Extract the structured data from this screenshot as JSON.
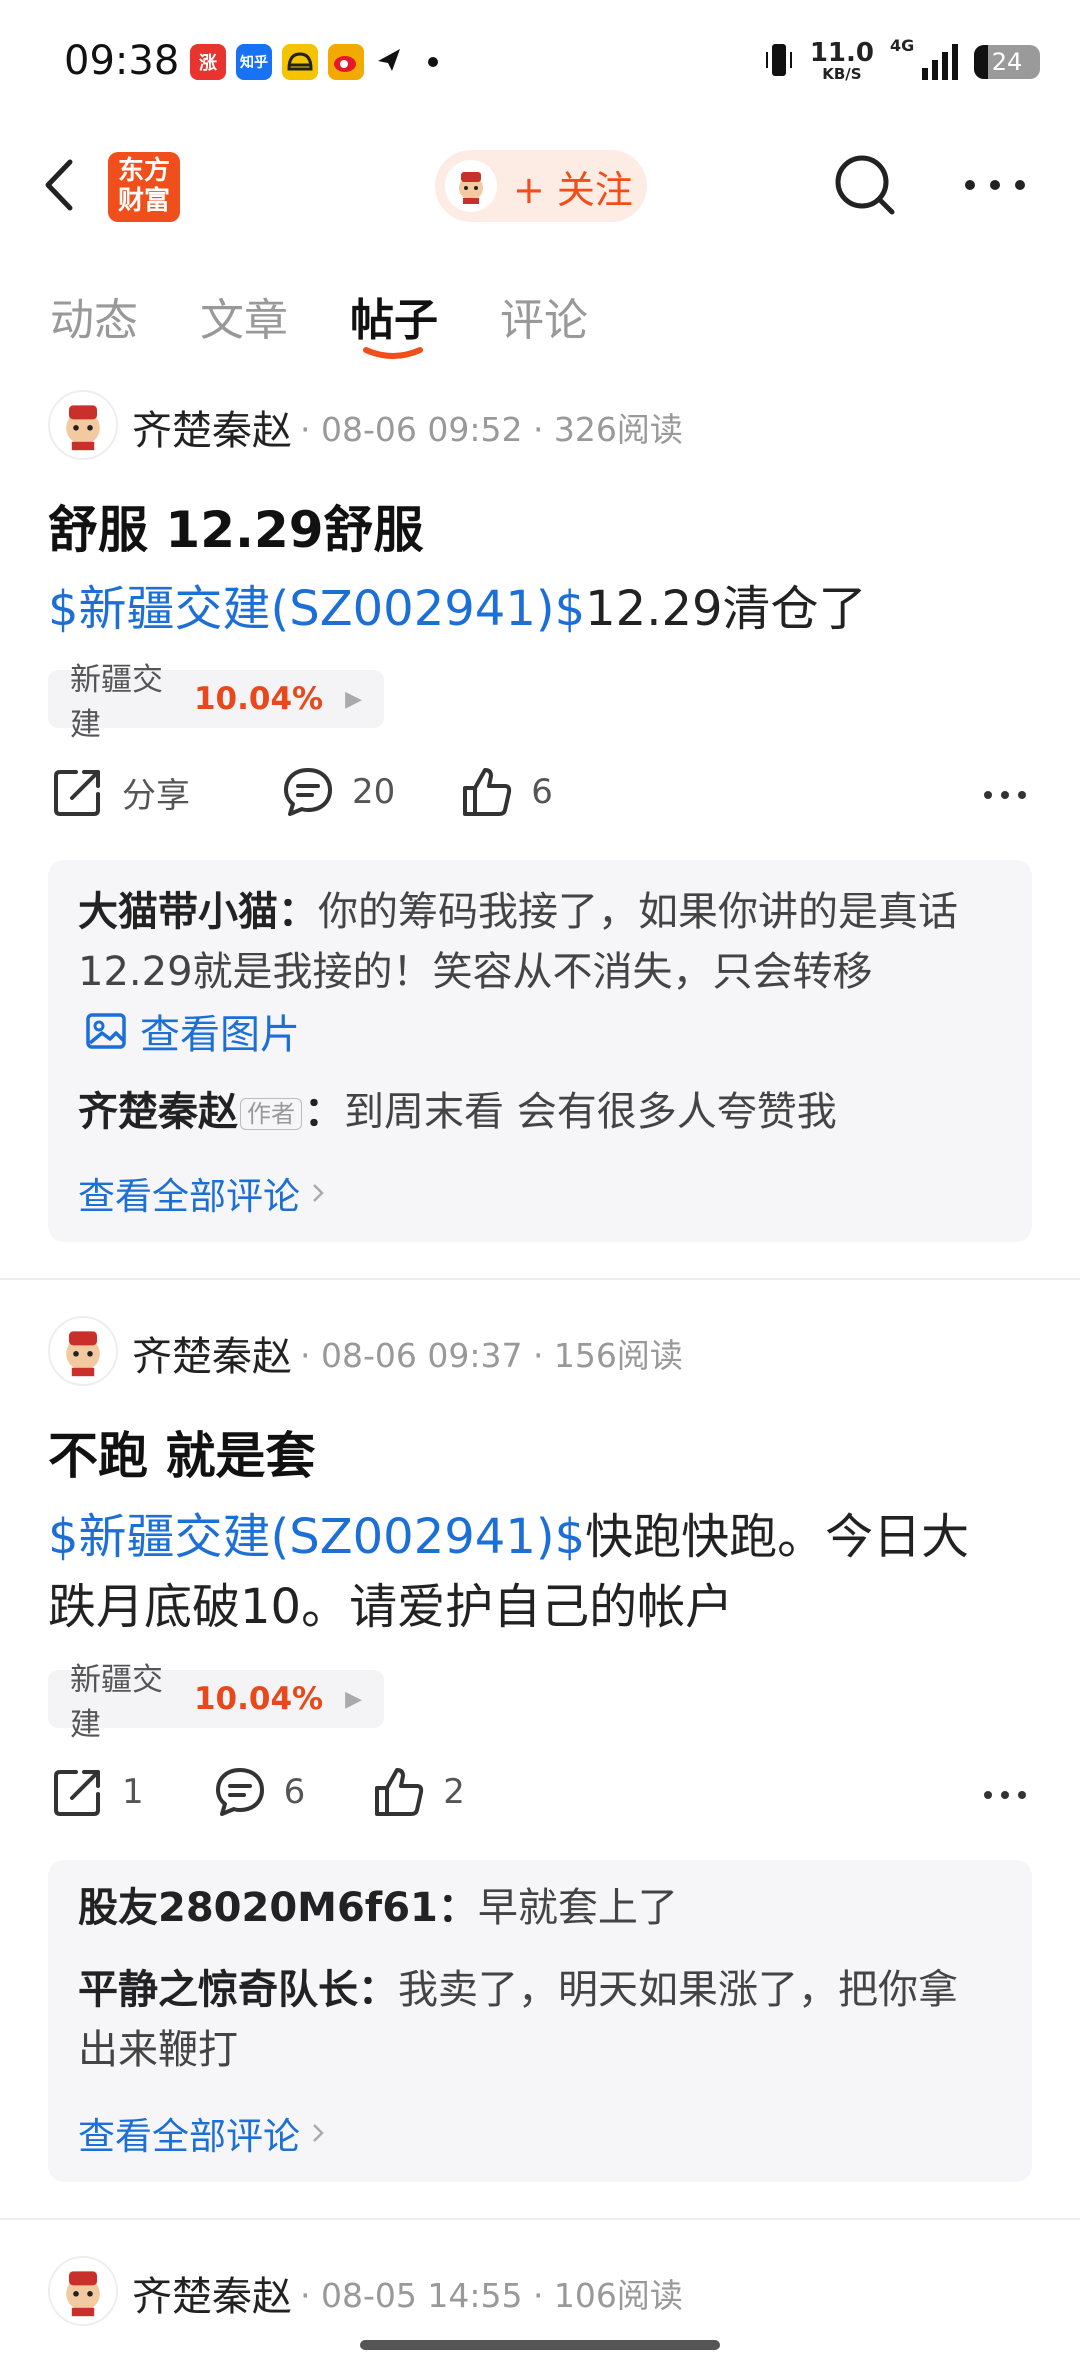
{
  "status_bar": {
    "time": "09:38",
    "apps": [
      {
        "label": "涨",
        "color": "#e8332e"
      },
      {
        "label": "知乎",
        "color": "#1772f6"
      },
      {
        "label": "",
        "color": "#f5c300"
      },
      {
        "label": "",
        "color": "#f2a900"
      }
    ],
    "net_speed_value": "11.0",
    "net_speed_unit": "KB/S",
    "network": "4G",
    "battery": "24"
  },
  "header": {
    "logo_line1": "东方",
    "logo_line2": "财富",
    "follow_label": "+ 关注",
    "accent": "#f04e1a"
  },
  "tabs": [
    {
      "label": "动态",
      "active": false
    },
    {
      "label": "文章",
      "active": false
    },
    {
      "label": "帖子",
      "active": true
    },
    {
      "label": "评论",
      "active": false
    }
  ],
  "posts": [
    {
      "author": "齐楚秦赵",
      "meta": "· 08-06 09:52 · 326阅读",
      "title": "舒服 12.29舒服",
      "stock_link": "$新疆交建(SZ002941)$",
      "body_line1": "12.29清仓了",
      "body_line2": "",
      "chip_name": "新疆交建",
      "chip_pct": "10.04%",
      "share": "分享",
      "comments": "20",
      "likes": "6",
      "comments_list": [
        {
          "user": "大猫带小猫：",
          "text": "你的筹码我接了，如果你讲的是真话",
          "text2": "12.29就是我接的！笑容从不消失，只会转移",
          "image_link": "查看图片"
        },
        {
          "user": "齐楚秦赵",
          "tag": "作者",
          "colon": "：",
          "text": "到周末看 会有很多人夸赞我"
        }
      ],
      "view_all": "查看全部评论"
    },
    {
      "author": "齐楚秦赵",
      "meta": "· 08-06 09:37 · 156阅读",
      "title": "不跑 就是套",
      "stock_link": "$新疆交建(SZ002941)$",
      "body_line1": "快跑快跑。今日大",
      "body_line2": "跌月底破10。请爱护自己的帐户",
      "chip_name": "新疆交建",
      "chip_pct": "10.04%",
      "share": "1",
      "comments": "6",
      "likes": "2",
      "comments_list": [
        {
          "user": "股友28020M6f61：",
          "text": "早就套上了"
        },
        {
          "user": "平静之惊奇队长：",
          "text": "我卖了，明天如果涨了，把你拿",
          "text2": "出来鞭打"
        }
      ],
      "view_all": "查看全部评论"
    },
    {
      "author": "齐楚秦赵",
      "meta": "· 08-05 14:55 · 106阅读"
    }
  ]
}
